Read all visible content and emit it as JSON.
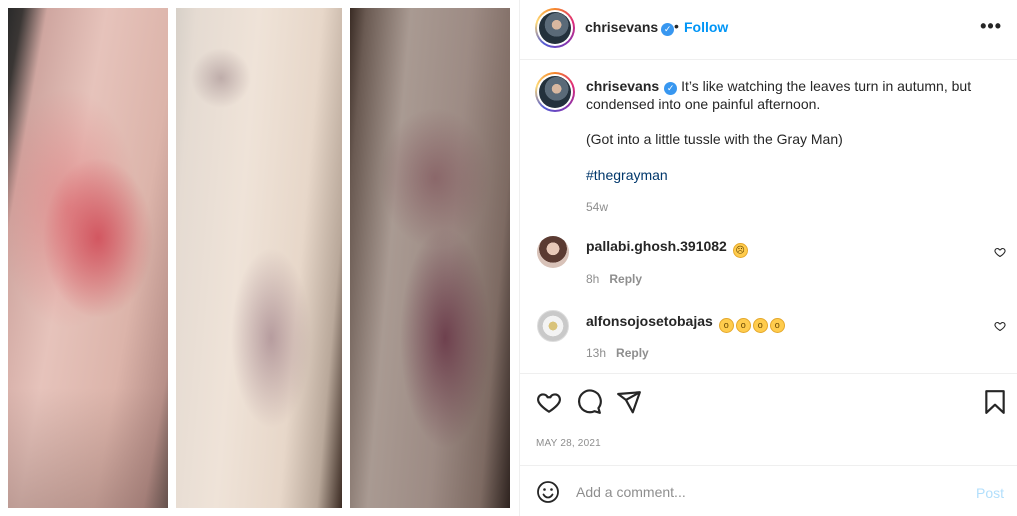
{
  "post": {
    "username": "chrisevans",
    "header_dot": "•",
    "follow_label": "Follow",
    "more_label": "•••",
    "caption": {
      "text_line1": "It’s like watching the leaves turn in autumn, but",
      "text_line2": "condensed into one painful afternoon.",
      "paren": "(Got into a little tussle with the Gray Man)",
      "hashtag": "#thegrayman",
      "time": "54w"
    },
    "comments": [
      {
        "username": "pallabi.ghosh.391082",
        "emojis": [
          "☹"
        ],
        "time": "8h",
        "reply_label": "Reply"
      },
      {
        "username": "alfonsojosetobajas",
        "emojis": [
          "o",
          "o",
          "o",
          "o"
        ],
        "time": "13h",
        "reply_label": "Reply"
      }
    ],
    "date": "MAY 28, 2021",
    "add_comment": {
      "placeholder": "Add a comment...",
      "post_label": "Post"
    }
  },
  "icons": {
    "verified": "verified-badge",
    "like": "heart-icon",
    "comment": "comment-icon",
    "share": "paper-plane-icon",
    "save": "bookmark-icon",
    "emoji": "smiley-icon"
  },
  "colors": {
    "accent": "#0095f6",
    "verified": "#3897f0",
    "hashtag": "#00376b",
    "secondary_text": "#8e8e8e",
    "post_disabled": "#b2dffc"
  }
}
